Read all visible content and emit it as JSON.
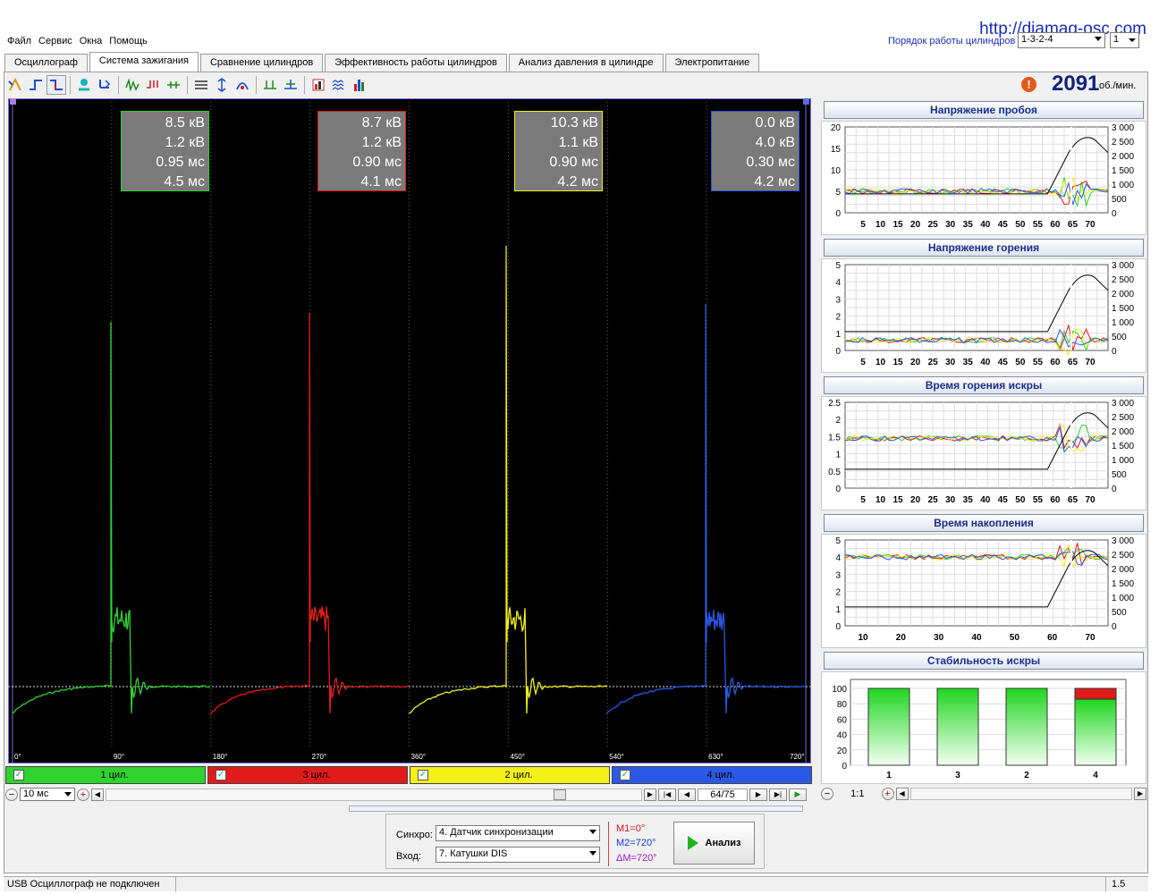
{
  "url": "http://diamag-osc.com",
  "menu": [
    "Файл",
    "Сервис",
    "Окна",
    "Помощь"
  ],
  "firing_order": {
    "label": "Порядок работы цилиндров",
    "value": "1-3-2-4",
    "num": "1"
  },
  "tabs": [
    "Осциллограф",
    "Система зажигания",
    "Сравнение цилиндров",
    "Эффективность работы цилиндров",
    "Анализ давления в цилиндре",
    "Электропитание"
  ],
  "active_tab": 1,
  "rpm": {
    "value": "2091",
    "unit": "об./мин."
  },
  "cylinders": [
    {
      "name": "1 цил.",
      "color": "#2fd22f",
      "kv": "8.5 кВ",
      "kv2": "1.2 кВ",
      "ms": "0.95 мс",
      "ms2": "4.5 мс"
    },
    {
      "name": "3 цил.",
      "color": "#e11b1b",
      "kv": "8.7 кВ",
      "kv2": "1.2 кВ",
      "ms": "0.90 мс",
      "ms2": "4.1 мс"
    },
    {
      "name": "2 цил.",
      "color": "#f3f01a",
      "kv": "10.3 кВ",
      "kv2": "1.1 кВ",
      "ms": "0.90 мс",
      "ms2": "4.2 мс"
    },
    {
      "name": "4 цил.",
      "color": "#2c58e6",
      "kv": "0.0 кВ",
      "kv2": "4.0 кВ",
      "ms": "0.30 мс",
      "ms2": "4.2 мс"
    }
  ],
  "angle_ticks": [
    "0°",
    "90°",
    "180°",
    "270°",
    "360°",
    "450°",
    "540°",
    "630°",
    "720°"
  ],
  "markers": {
    "m1": "1",
    "m2": "2"
  },
  "nav": {
    "timebase": "10 мс",
    "frame": "64/75",
    "zoom": "1:1"
  },
  "sync": {
    "label": "Синхро:",
    "value": "4.  Датчик синхронизации"
  },
  "input": {
    "label": "Вход:",
    "value": "7.  Катушки DIS"
  },
  "m_values": {
    "m1": "M1=0°",
    "m2": "M2=720°",
    "dm": "ΔM=720°"
  },
  "analyze_label": "Анализ",
  "status": {
    "left": "USB Осциллограф не подключен",
    "right": "1.5"
  },
  "panels": [
    {
      "title": "Напряжение пробоя",
      "yticks": [
        "20",
        "15",
        "10",
        "5",
        "0"
      ],
      "xticks": [
        "5",
        "10",
        "15",
        "20",
        "25",
        "30",
        "35",
        "40",
        "45",
        "50",
        "55",
        "60",
        "65",
        "70"
      ],
      "rticks": [
        "3 000",
        "2 500",
        "2 000",
        "1 500",
        "1 000",
        "500",
        "0"
      ]
    },
    {
      "title": "Напряжение горения",
      "yticks": [
        "5",
        "4",
        "3",
        "2",
        "1",
        "0"
      ],
      "xticks": [
        "5",
        "10",
        "15",
        "20",
        "25",
        "30",
        "35",
        "40",
        "45",
        "50",
        "55",
        "60",
        "65",
        "70"
      ],
      "rticks": [
        "3 000",
        "2 500",
        "2 000",
        "1 500",
        "1 000",
        "500",
        "0"
      ]
    },
    {
      "title": "Время горения искры",
      "yticks": [
        "2.5",
        "2",
        "1.5",
        "1",
        "0.5",
        "0"
      ],
      "xticks": [
        "5",
        "10",
        "15",
        "20",
        "25",
        "30",
        "35",
        "40",
        "45",
        "50",
        "55",
        "60",
        "65",
        "70"
      ],
      "rticks": [
        "3 000",
        "2 500",
        "2 000",
        "1 500",
        "1 000",
        "500",
        "0"
      ]
    },
    {
      "title": "Время накопления",
      "yticks": [
        "5",
        "4",
        "3",
        "2",
        "1",
        "0"
      ],
      "xticks": [
        "10",
        "20",
        "30",
        "40",
        "50",
        "60",
        "70"
      ],
      "rticks": [
        "3 000",
        "2 500",
        "2 000",
        "1 500",
        "1 000",
        "500",
        "0"
      ]
    }
  ],
  "stability": {
    "title": "Стабильность искры",
    "yticks": [
      "100",
      "80",
      "60",
      "40",
      "20",
      "0"
    ],
    "categories": [
      "1",
      "3",
      "2",
      "4"
    ],
    "values": [
      100,
      100,
      100,
      86
    ]
  }
}
